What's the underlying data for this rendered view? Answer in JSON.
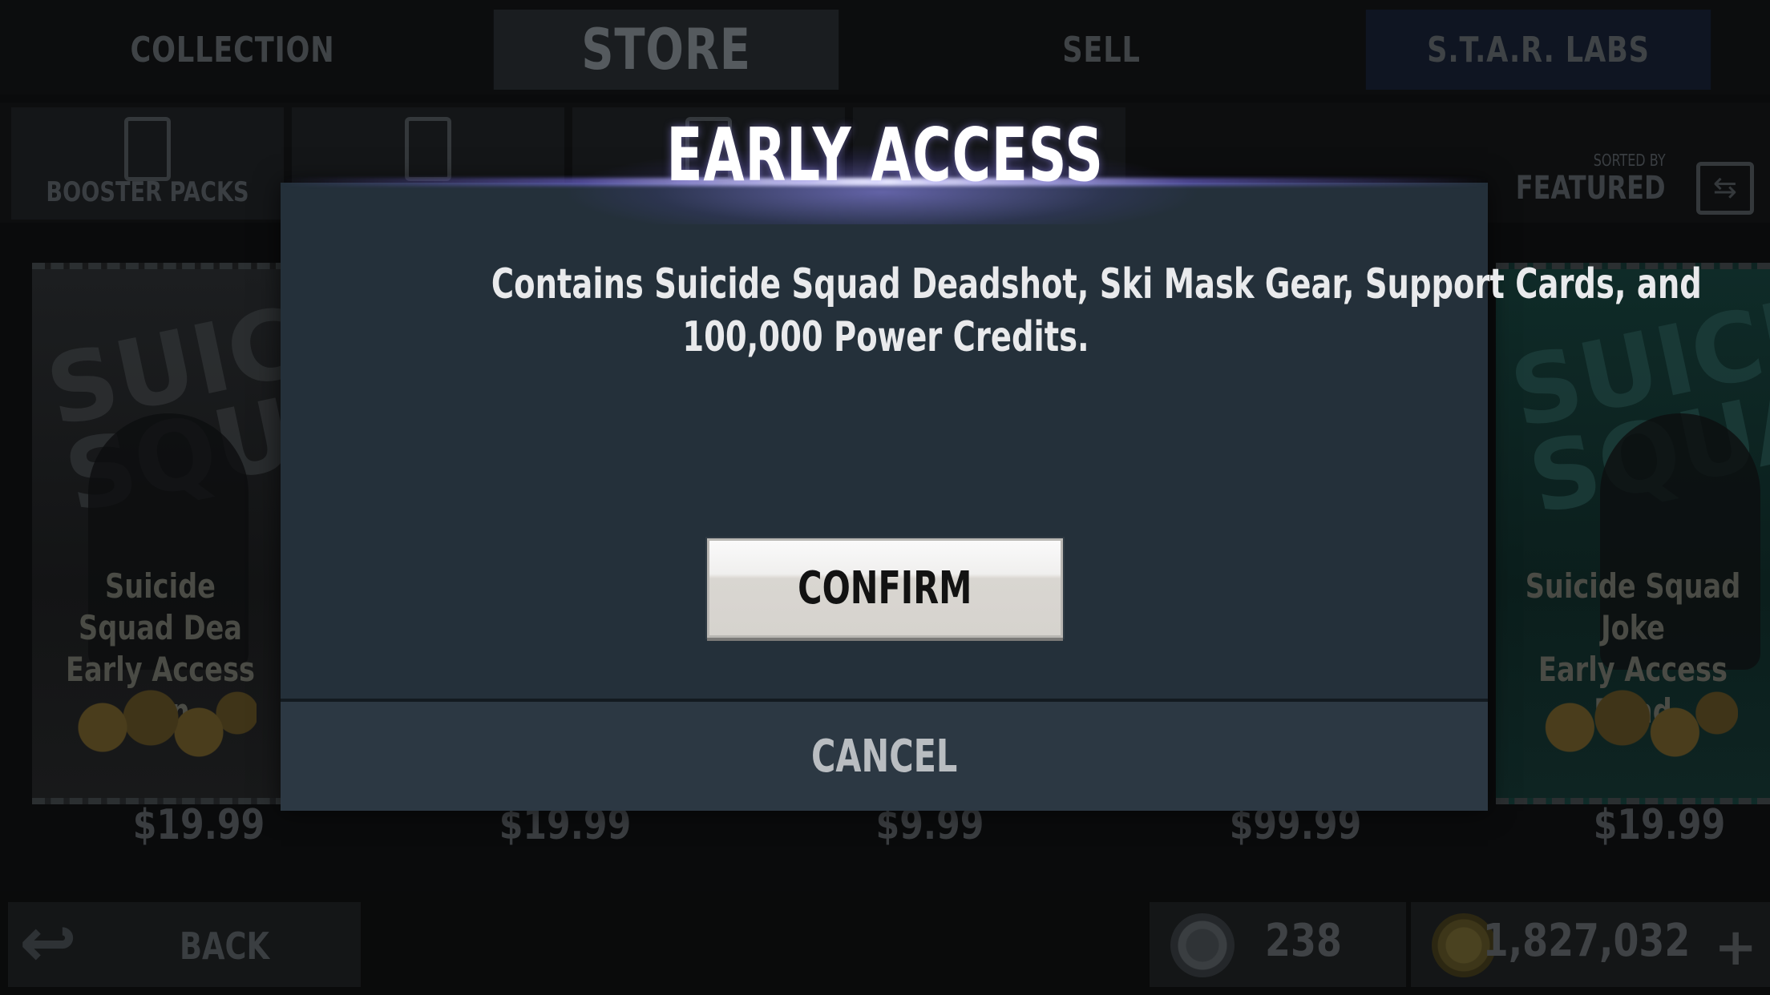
{
  "top_tabs": [
    {
      "label": "COLLECTION"
    },
    {
      "label": "STORE"
    },
    {
      "label": "SELL"
    },
    {
      "label": "S.T.A.R. LABS"
    }
  ],
  "sub_tabs": {
    "booster_packs_label": "BOOSTER PACKS"
  },
  "sort": {
    "caption": "SORTED BY",
    "value": "FEATURED"
  },
  "packs": [
    {
      "name_line1": "Suicide Squad Dea",
      "name_line2": "Early Access Bun",
      "brand": "SUICIDE SQUAD",
      "price": "$19.99"
    },
    {
      "name_line1": "Suicide Squad Joke",
      "name_line2": "Early Access Bund",
      "brand": "SUICIDE SQUAD",
      "price": "$19.99"
    }
  ],
  "hidden_prices": [
    "$19.99",
    "$9.99",
    "$99.99"
  ],
  "bottom_bar": {
    "back_label": "BACK",
    "currency_small": "238",
    "currency_large": "1,827,032"
  },
  "dialog": {
    "title": "EARLY ACCESS",
    "message_line1": "Contains Suicide Squad Deadshot, Ski Mask Gear, Support Cards, and",
    "message_line2": "100,000 Power Credits.",
    "confirm_label": "CONFIRM",
    "cancel_label": "CANCEL"
  },
  "icons": {
    "back": "back-arrow-icon",
    "small_currency": "alliance-coin-icon",
    "large_currency": "power-credits-coin-icon",
    "add": "plus-icon",
    "sort": "sort-toggle-icon"
  },
  "colors": {
    "dialog_bg": "#24303a",
    "cancel_bg": "#2c3843",
    "confirm_bg": "#e8e6e2",
    "glow": "#8f86ff"
  }
}
